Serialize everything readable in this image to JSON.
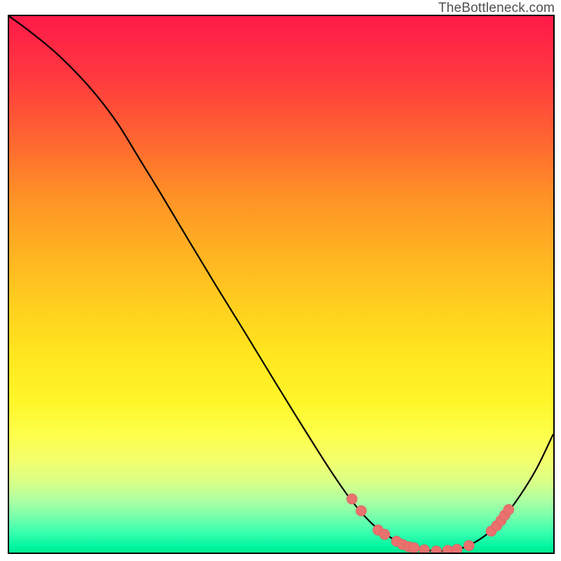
{
  "brand": {
    "watermark": "TheBottleneck.com"
  },
  "chart_data": {
    "type": "line",
    "title": "",
    "xlabel": "",
    "ylabel": "",
    "xlim": [
      0,
      100
    ],
    "ylim": [
      0,
      100
    ],
    "grid": false,
    "series": [
      {
        "name": "bottleneck-curve",
        "x": [
          0,
          4,
          8,
          12,
          16,
          20,
          24,
          28,
          33,
          38,
          43,
          49,
          54,
          59,
          63,
          67,
          71,
          75,
          78.5,
          82,
          85,
          88,
          91,
          94,
          97,
          100
        ],
        "y": [
          100,
          97,
          93.7,
          89.8,
          85.3,
          79.9,
          73.3,
          66.7,
          58.2,
          49.8,
          41.6,
          31.6,
          23.4,
          15.4,
          9.6,
          5.1,
          2.3,
          0.8,
          0.3,
          0.5,
          1.6,
          3.6,
          6.7,
          10.8,
          15.8,
          22.1
        ]
      }
    ],
    "markers": {
      "name": "optimal-range-dots",
      "color": "#e9716e",
      "points": [
        {
          "x": 63.0,
          "y": 10.0
        },
        {
          "x": 64.7,
          "y": 7.8
        },
        {
          "x": 67.8,
          "y": 4.2
        },
        {
          "x": 69.0,
          "y": 3.4
        },
        {
          "x": 71.2,
          "y": 2.1
        },
        {
          "x": 72.3,
          "y": 1.5
        },
        {
          "x": 73.4,
          "y": 1.1
        },
        {
          "x": 74.4,
          "y": 0.9
        },
        {
          "x": 76.3,
          "y": 0.5
        },
        {
          "x": 78.5,
          "y": 0.3
        },
        {
          "x": 80.6,
          "y": 0.4
        },
        {
          "x": 82.3,
          "y": 0.6
        },
        {
          "x": 84.5,
          "y": 1.3
        },
        {
          "x": 88.6,
          "y": 4.0
        },
        {
          "x": 89.6,
          "y": 5.0
        },
        {
          "x": 90.4,
          "y": 6.0
        },
        {
          "x": 91.1,
          "y": 7.0
        },
        {
          "x": 91.8,
          "y": 8.0
        }
      ]
    },
    "legend": null,
    "annotations": []
  }
}
